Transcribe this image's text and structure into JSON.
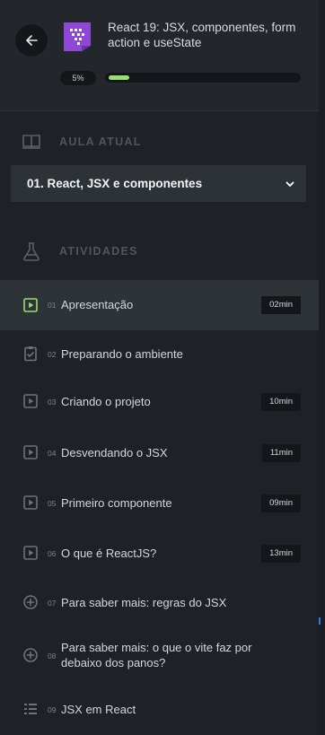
{
  "header": {
    "back_icon": "arrow-left-icon",
    "course_icon": "react-course-badge-icon",
    "course_title": "React 19: JSX, componentes, form action e useState",
    "progress_label": "5%",
    "progress_fraction": 0.05,
    "progress_color": "#97e070"
  },
  "current_lesson": {
    "heading": "AULA ATUAL",
    "icon": "open-book-icon",
    "selected": "01. React, JSX e componentes"
  },
  "activities": {
    "heading": "ATIVIDADES",
    "icon": "flask-icon",
    "items": [
      {
        "num": "01",
        "title": "Apresentação",
        "duration": "02min",
        "icon": "video-play-icon",
        "active": true
      },
      {
        "num": "02",
        "title": "Preparando o ambiente",
        "duration": "",
        "icon": "clipboard-check-icon",
        "active": false
      },
      {
        "num": "03",
        "title": "Criando o projeto",
        "duration": "10min",
        "icon": "video-play-icon",
        "active": false
      },
      {
        "num": "04",
        "title": "Desvendando o JSX",
        "duration": "11min",
        "icon": "video-play-icon",
        "active": false
      },
      {
        "num": "05",
        "title": "Primeiro componente",
        "duration": "09min",
        "icon": "video-play-icon",
        "active": false
      },
      {
        "num": "06",
        "title": "O que é ReactJS?",
        "duration": "13min",
        "icon": "video-play-icon",
        "active": false
      },
      {
        "num": "07",
        "title": "Para saber mais: regras do JSX",
        "duration": "",
        "icon": "plus-circle-icon",
        "active": false
      },
      {
        "num": "08",
        "title": "Para saber mais: o que o vite faz por debaixo dos panos?",
        "duration": "",
        "icon": "plus-circle-icon",
        "active": false
      },
      {
        "num": "09",
        "title": "JSX em React",
        "duration": "",
        "icon": "list-icon",
        "active": false
      }
    ]
  },
  "colors": {
    "active_icon": "#97e070",
    "muted_icon": "#6c737a",
    "accent_marker": "#2f7be0"
  }
}
